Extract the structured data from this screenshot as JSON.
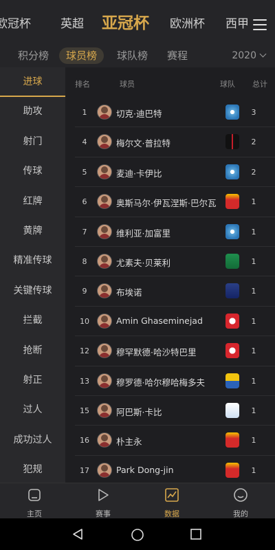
{
  "league_tabs": [
    "欧冠杯",
    "英超",
    "亚冠杯",
    "欧洲杯",
    "西甲"
  ],
  "sub_tabs": [
    "积分榜",
    "球员榜",
    "球队榜",
    "赛程"
  ],
  "season": "2020",
  "categories": [
    "进球",
    "助攻",
    "射门",
    "传球",
    "红牌",
    "黄牌",
    "精准传球",
    "关键传球",
    "拦截",
    "抢断",
    "射正",
    "过人",
    "成功过人",
    "犯规"
  ],
  "table_header": {
    "rank": "排名",
    "player": "球员",
    "team": "球队",
    "total": "总计"
  },
  "rows": [
    {
      "rank": "1",
      "name": "切克·迪巴特",
      "total": "3",
      "team_icon": "team-badge-blue"
    },
    {
      "rank": "4",
      "name": "梅尔文·普拉特",
      "total": "2",
      "team_icon": "team-badge-black"
    },
    {
      "rank": "5",
      "name": "麦迪·卡伊比",
      "total": "2",
      "team_icon": "team-badge-blue"
    },
    {
      "rank": "6",
      "name": "奥斯马尔·伊瓦涅斯·巴尔瓦",
      "total": "1",
      "team_icon": "team-badge-seoul"
    },
    {
      "rank": "7",
      "name": "维利亚·加富里",
      "total": "1",
      "team_icon": "team-badge-blue"
    },
    {
      "rank": "8",
      "name": "尤素夫·贝莱利",
      "total": "1",
      "team_icon": "team-badge-green"
    },
    {
      "rank": "9",
      "name": "布埃诺",
      "total": "1",
      "team_icon": "team-badge-navy"
    },
    {
      "rank": "10",
      "name": "Amin Ghaseminejad",
      "total": "1",
      "team_icon": "team-badge-red"
    },
    {
      "rank": "12",
      "name": "穆罕默德·哈沙特巴里",
      "total": "1",
      "team_icon": "team-badge-red"
    },
    {
      "rank": "13",
      "name": "穆罗德·哈尔穆哈梅多夫",
      "total": "1",
      "team_icon": "team-badge-yellow-blue"
    },
    {
      "rank": "15",
      "name": "阿巴斯·卡比",
      "total": "1",
      "team_icon": "team-badge-white-blue"
    },
    {
      "rank": "16",
      "name": "朴主永",
      "total": "1",
      "team_icon": "team-badge-seoul"
    },
    {
      "rank": "17",
      "name": "Park Dong-jin",
      "total": "1",
      "team_icon": "team-badge-seoul"
    }
  ],
  "bottom_tabs": [
    "主页",
    "赛事",
    "数据",
    "我的"
  ],
  "colors": {
    "accent": "#d8a84c",
    "background": "#1e1e21",
    "panel": "#29292c"
  }
}
